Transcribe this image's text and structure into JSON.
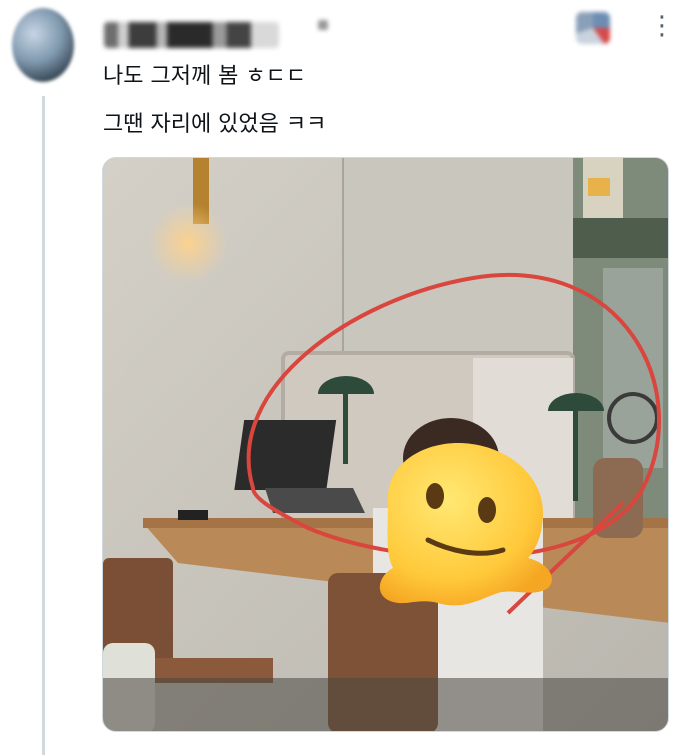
{
  "tweet": {
    "author_avatar": "blurred-avatar",
    "author_name": "",
    "line1": "나도 그저께 봄 ㅎㄷㄷ",
    "line2": "그땐 자리에 있었음 ㅋㅋ"
  },
  "media": {
    "icons": [
      "melting-face-emoji"
    ],
    "annotation_color": "#d9463e"
  },
  "actions": {
    "more_icon": "more-icon"
  }
}
